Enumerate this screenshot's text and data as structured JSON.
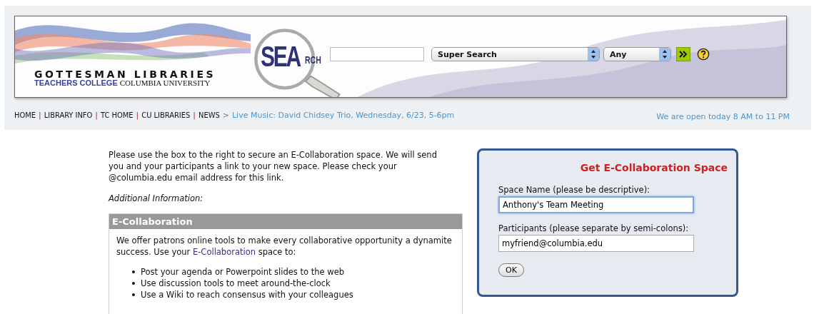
{
  "header": {
    "logo_title": "GOTTESMAN LIBRARIES",
    "logo_college": "TEACHERS COLLEGE",
    "logo_university": "COLUMBIA UNIVERSITY",
    "search_logo_big": "SEA",
    "search_logo_small": "RCH"
  },
  "search": {
    "scope": "Super Search",
    "field": "Any"
  },
  "nav": {
    "items": [
      {
        "label": "HOME",
        "separator": "|"
      },
      {
        "label": "LIBRARY INFO",
        "separator": "|"
      },
      {
        "label": "TC HOME",
        "separator": "|"
      },
      {
        "label": "CU LIBRARIES",
        "separator": "|"
      },
      {
        "label": "NEWS",
        "separator": ">"
      }
    ],
    "news": "Live Music: David Chidsey Trio, Wednesday, 6/23, 5-6pm",
    "hours": "We are open today 8 AM to 11 PM"
  },
  "intro": "Please use the box to the right to secure an E-Collaboration space. We will send you and your participants a link to your new space. Please check your @columbia.edu email address for this link.",
  "additional": "Additional Information:",
  "info_box": {
    "title": "E-Collaboration",
    "text_before": "We offer patrons online tools to make every collaborative opportunity a dynamite success. Use your",
    "link": "E-Collaboration",
    "text_after": "space to:",
    "bullets": [
      "Post your agenda or Powerpoint slides to the web",
      "Use discussion tools to meet around-the-clock",
      "Use a Wiki to reach consensus with your colleagues"
    ]
  },
  "form": {
    "title": "Get E-Collaboration Space",
    "fields": [
      {
        "label": "Space Name (please be descriptive):",
        "value": "Anthony's Team Meeting",
        "focused": true
      },
      {
        "label": "Participants (please separate by semi-colons):",
        "value": "myfriend@columbia.edu",
        "focused": false
      }
    ],
    "button": "OK"
  }
}
